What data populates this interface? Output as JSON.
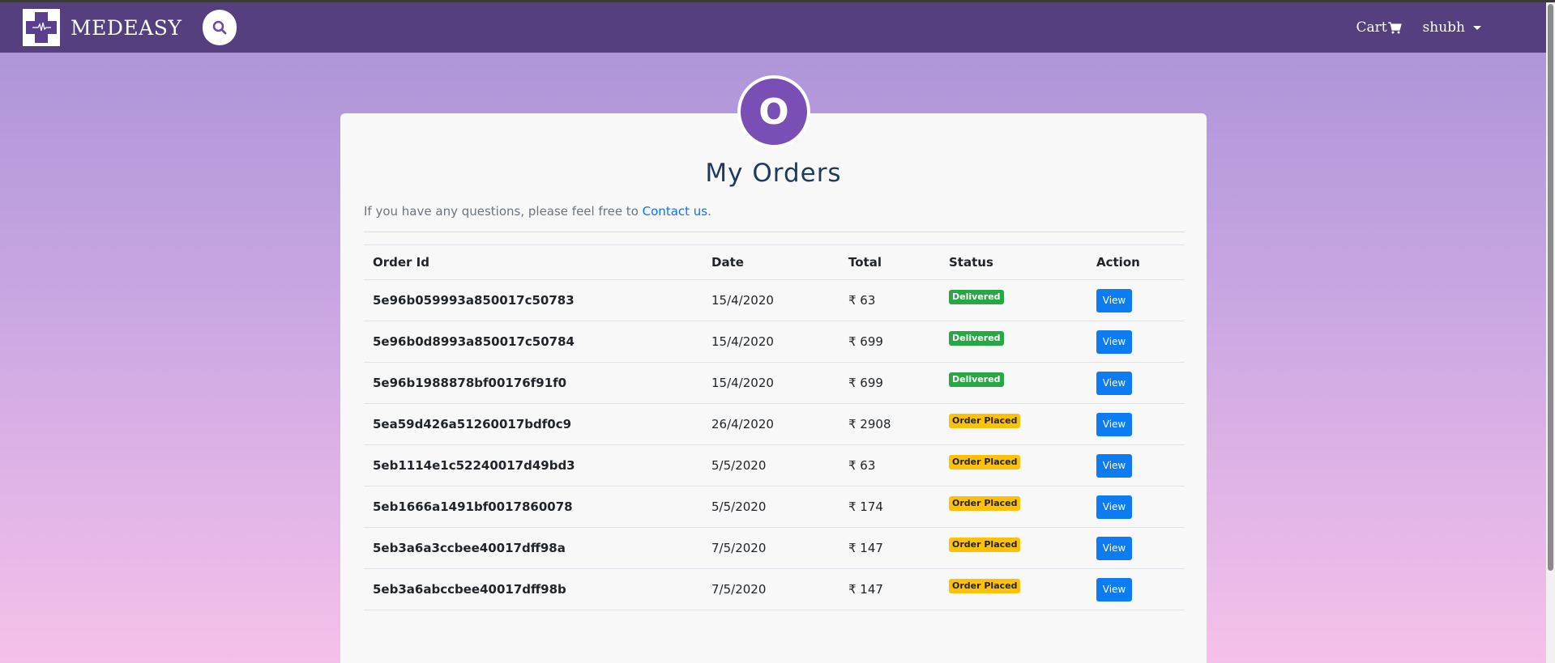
{
  "navbar": {
    "brand": "MEDEASY",
    "cart_label": "Cart",
    "user_name": "shubh"
  },
  "page": {
    "avatar_letter": "O",
    "title": "My Orders",
    "intro_text": "If you have any questions, please feel free to",
    "contact_link": "Contact us",
    "intro_suffix": "."
  },
  "table": {
    "headers": [
      "Order Id",
      "Date",
      "Total",
      "Status",
      "Action"
    ],
    "rows": [
      {
        "id": "5e96b059993a850017c50783",
        "date": "15/4/2020",
        "total": "₹ 63",
        "status": "Delivered",
        "action": "View"
      },
      {
        "id": "5e96b0d8993a850017c50784",
        "date": "15/4/2020",
        "total": "₹ 699",
        "status": "Delivered",
        "action": "View"
      },
      {
        "id": "5e96b1988878bf00176f91f0",
        "date": "15/4/2020",
        "total": "₹ 699",
        "status": "Delivered",
        "action": "View"
      },
      {
        "id": "5ea59d426a51260017bdf0c9",
        "date": "26/4/2020",
        "total": "₹ 2908",
        "status": "Order Placed",
        "action": "View"
      },
      {
        "id": "5eb1114e1c52240017d49bd3",
        "date": "5/5/2020",
        "total": "₹ 63",
        "status": "Order Placed",
        "action": "View"
      },
      {
        "id": "5eb1666a1491bf0017860078",
        "date": "5/5/2020",
        "total": "₹ 174",
        "status": "Order Placed",
        "action": "View"
      },
      {
        "id": "5eb3a6a3ccbee40017dff98a",
        "date": "7/5/2020",
        "total": "₹ 147",
        "status": "Order Placed",
        "action": "View"
      },
      {
        "id": "5eb3a6abccbee40017dff98b",
        "date": "7/5/2020",
        "total": "₹ 147",
        "status": "Order Placed",
        "action": "View"
      }
    ]
  },
  "colors": {
    "navbar": "#553f7f",
    "delivered": "#28a745",
    "order_placed": "#ffc107",
    "button": "#0d7cf2",
    "avatar": "#7a4fb5"
  },
  "icons": {
    "logo": "medical-cross-icon",
    "search": "search-icon",
    "cart": "cart-icon",
    "user_menu": "caret-down-icon"
  }
}
